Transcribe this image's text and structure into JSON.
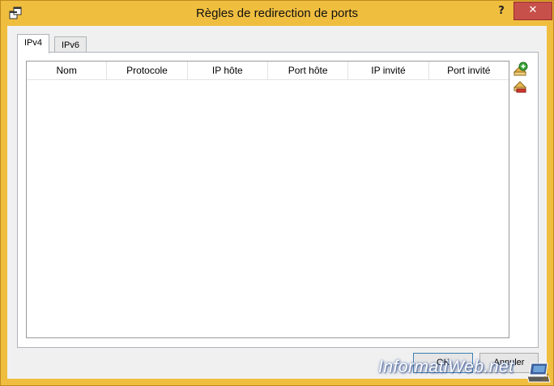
{
  "window": {
    "title": "Règles de redirection de ports",
    "help_label": "?",
    "close_label": "✕"
  },
  "tabs": [
    {
      "label": "IPv4",
      "active": true
    },
    {
      "label": "IPv6",
      "active": false
    }
  ],
  "table": {
    "columns": [
      "Nom",
      "Protocole",
      "IP hôte",
      "Port hôte",
      "IP invité",
      "Port invité"
    ],
    "rows": []
  },
  "side_buttons": {
    "add_icon": "add-rule-icon",
    "remove_icon": "remove-rule-icon"
  },
  "buttons": {
    "ok_label": "OK",
    "cancel_label": "Annuler"
  },
  "watermark": {
    "text": "InformatiWeb.net"
  },
  "colors": {
    "title_bar": "#f0be3f",
    "close_button": "#c7504a",
    "dialog_background": "#f0f0f0",
    "add_icon": "#3aa53a",
    "remove_icon": "#d2382c"
  }
}
